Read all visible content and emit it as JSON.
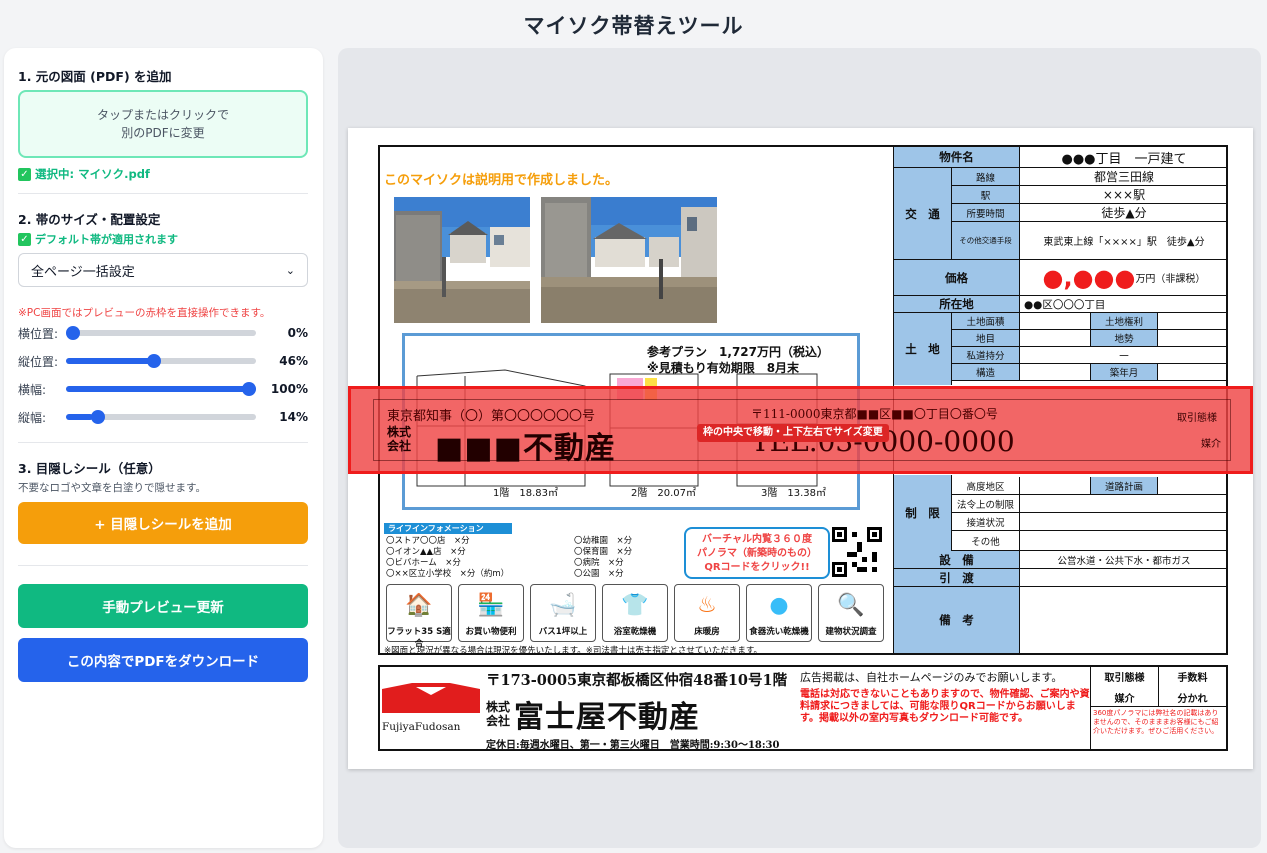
{
  "app_title": "マイソク帯替えツール",
  "section1": {
    "title": "1. 元の図面 (PDF) を追加",
    "dropzone_line1": "タップまたはクリックで",
    "dropzone_line2": "別のPDFに変更",
    "selected": "選択中: マイソク.pdf"
  },
  "section2": {
    "title": "2. 帯のサイズ・配置設定",
    "default_note": "デフォルト帯が適用されます",
    "select_value": "全ページ一括設定",
    "pc_note": "※PC画面ではプレビューの赤枠を直接操作できます。",
    "sliders": [
      {
        "label": "横位置:",
        "value": 0,
        "display": "0%"
      },
      {
        "label": "縦位置:",
        "value": 46,
        "display": "46%"
      },
      {
        "label": "横幅:",
        "value": 100,
        "display": "100%"
      },
      {
        "label": "縦幅:",
        "value": 14,
        "display": "14%"
      }
    ]
  },
  "section3": {
    "title": "3. 目隠しシール（任意）",
    "desc": "不要なロゴや文章を白塗りで隠せます。",
    "add_button": "+ 目隠しシールを追加"
  },
  "buttons": {
    "preview": "手動プレビュー更新",
    "download": "この内容でPDFをダウンロード"
  },
  "colors": {
    "accent_green": "#10b981",
    "orange": "#f59e0b",
    "blue": "#2563eb",
    "red_frame": "#ef1c1c"
  },
  "sheet": {
    "orange_note": "このマイソクは説明用で作成しました。",
    "plan_line1": "参考プラン　1,727万円（税込）",
    "plan_line2": "※見積もり有効期限　8月末",
    "floors": [
      "1階　18.83㎡",
      "2階　20.07㎡",
      "3階　13.38㎡"
    ],
    "life_title": "ライフインフォメーション",
    "life_left": [
      "〇ストア〇〇店　×分",
      "〇イオン▲▲店　×分",
      "〇ビバホーム　×分",
      "〇××区立小学校　×分（約m）"
    ],
    "life_right": [
      "〇幼稚園　×分",
      "〇保育園　×分",
      "〇病院　×分",
      "〇公園　×分"
    ],
    "vr_text": [
      "バーチャル内覧３６０度",
      "パノラマ（新築時のもの）",
      "QRコードをクリック!!"
    ],
    "icons": [
      "フラット35 S適合",
      "お買い物便利",
      "バス1坪以上",
      "浴室乾燥機",
      "床暖房",
      "食器洗い乾燥機",
      "建物状況調査"
    ],
    "bottom_note": "※図面と現況が異なる場合は現況を優先いたします。※司法書士は売主指定とさせていただきます。",
    "table": {
      "bukken_label": "物件名",
      "bukken_value": "●●●丁目　一戸建て",
      "kotsu_label": "交　通",
      "rosen_label": "路線",
      "rosen_value": "都営三田線",
      "eki_label": "駅",
      "eki_value": "×××駅",
      "jikan_label": "所要時間",
      "jikan_value": "徒歩▲分",
      "other_label": "その他交通手段",
      "other_value": "東武東上線「××××」駅　徒歩▲分",
      "price_label": "価格",
      "price_value": "●,●●●",
      "price_unit": "万円（非課税）",
      "addr_label": "所在地",
      "addr_value": "●●区〇〇〇丁目",
      "tochi_label": "土　地",
      "menseki_label": "土地面積",
      "kenri_label": "土地権利",
      "chimoku_label": "地目",
      "chisei_label": "地勢",
      "shido_label": "私道持分",
      "shido_value": "－",
      "kozo_label": "構造",
      "chikunen_label": "築年月",
      "seigen_label": "制　限",
      "kodo_label": "高度地区",
      "doro_label": "道路計画",
      "hoho_label": "法令上の制限",
      "setsudo_label": "接道状況",
      "sonota_label": "その他",
      "setsubi_label": "設　備",
      "setsubi_value": "公営水道・公共下水・都市ガス",
      "hikiwatashi_label": "引　渡",
      "biko_label": "備　考"
    }
  },
  "obi": {
    "license": "東京都知事（〇）第〇〇〇〇〇〇号",
    "corp_prefix_1": "株式",
    "corp_prefix_2": "会社",
    "company": "■■■不動産",
    "address": "〒111-0000東京都■■区■■〇丁目〇番〇号",
    "tel": "TEL.03-0000-0000",
    "drag_hint": "枠の中央で移動・上下左右でサイズ変更",
    "right1": "取引態様",
    "right2": "媒介"
  },
  "footer": {
    "logo_text": "FujiyaFudosan",
    "address": "〒173-0005東京都板橋区仲宿48番10号1階",
    "corp_prefix_1": "株式",
    "corp_prefix_2": "会社",
    "company": "富士屋不動産",
    "hours": "定休日:毎週水曜日、第一・第三火曜日　営業時間:9:30～18:30",
    "ad_note": "広告掲載は、自社ホームページのみでお願いします。",
    "red_note": "電話は対応できないこともありますので、物件確認、ご案内や資料請求につきましては、可能な限りQRコードからお願いします。掲載以外の室内写真もダウンロード可能です。",
    "torihiki_label": "取引態様",
    "torihiki_value": "媒介",
    "fee_label": "手数料",
    "fee_value": "分かれ",
    "small_note": "360度パノラマには弊社名の記載はありませんので、そのまままお客様にもご紹介いただけます。ぜひご活用ください。"
  }
}
